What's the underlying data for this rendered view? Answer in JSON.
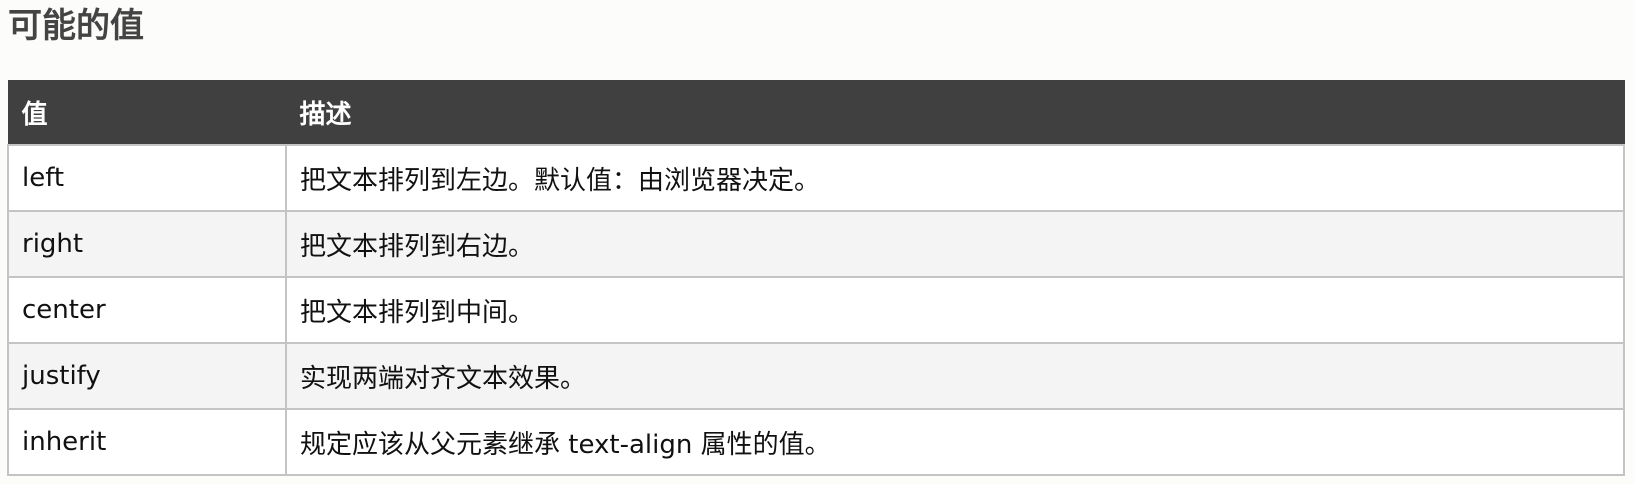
{
  "heading": "可能的值",
  "table": {
    "headers": [
      "值",
      "描述"
    ],
    "rows": [
      {
        "value": "left",
        "description": "把文本排列到左边。默认值：由浏览器决定。"
      },
      {
        "value": "right",
        "description": "把文本排列到右边。"
      },
      {
        "value": "center",
        "description": "把文本排列到中间。"
      },
      {
        "value": "justify",
        "description": "实现两端对齐文本效果。"
      },
      {
        "value": "inherit",
        "description": "规定应该从父元素继承 text-align 属性的值。"
      }
    ]
  },
  "colors": {
    "header_bg": "#404040",
    "header_text": "#ffffff",
    "row_alt_bg": "#f4f4f4",
    "border": "#c4c4c4",
    "title_text": "#444444"
  }
}
